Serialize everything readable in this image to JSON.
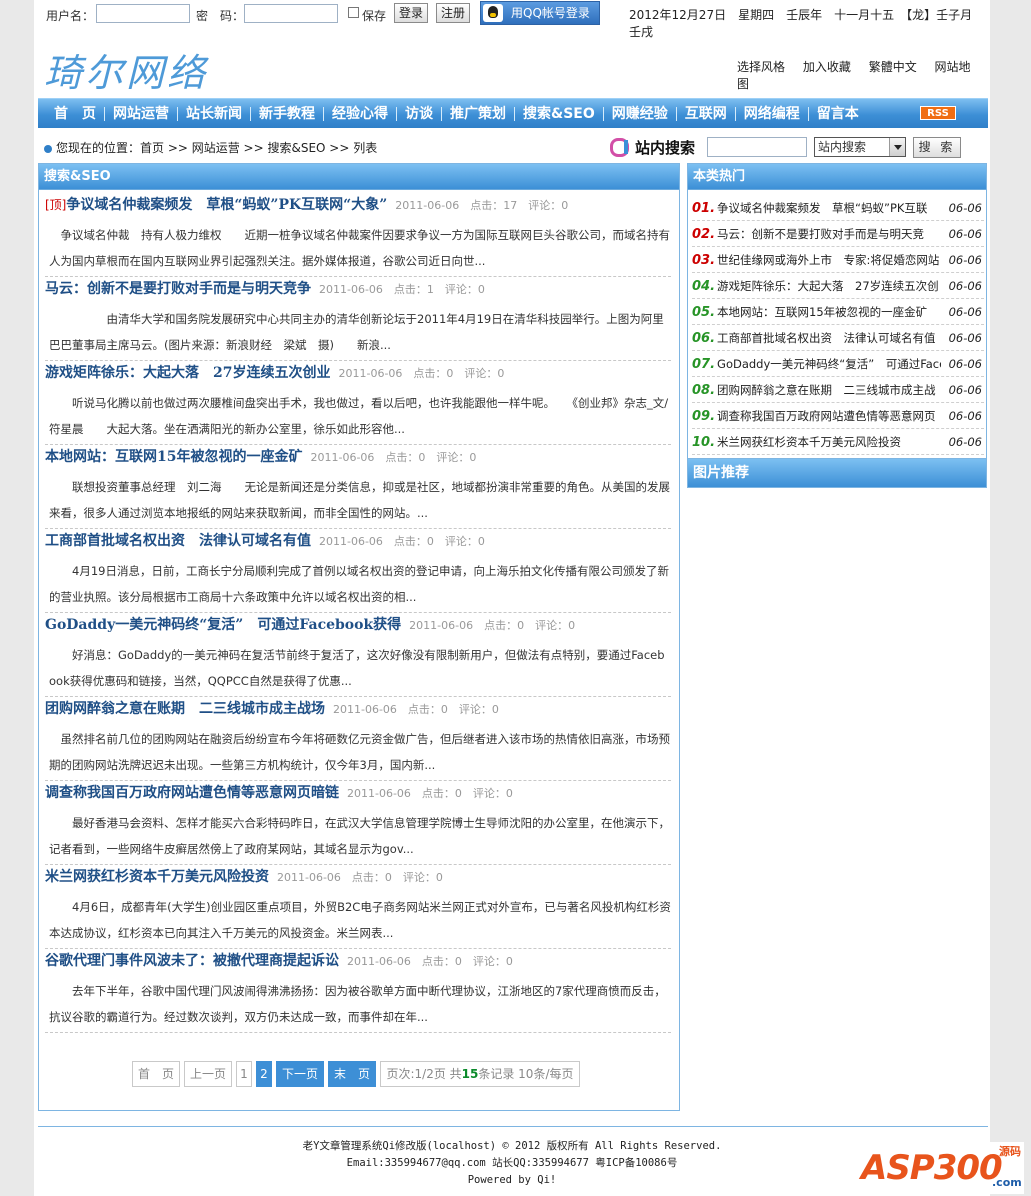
{
  "topbar": {
    "user_label": "用户名：",
    "pwd_label": "密　码：",
    "save_label": "保存",
    "login_btn": "登录",
    "register_btn": "注册",
    "qq_btn": "用QQ帐号登录",
    "date": "2012年12月27日　星期四　壬辰年　十一月十五　【龙】壬子月　壬戌"
  },
  "header": {
    "logo": "琦尔网络",
    "links": [
      "选择风格",
      "加入收藏",
      "繁體中文",
      "网站地图"
    ]
  },
  "nav": {
    "items": [
      "首　页",
      "网站运营",
      "站长新闻",
      "新手教程",
      "经验心得",
      "访谈",
      "推广策划",
      "搜索&SEO",
      "网赚经验",
      "互联网",
      "网络编程",
      "留言本"
    ],
    "rss": "RSS"
  },
  "location": {
    "text": "您现在的位置：首页 >> 网站运营 >> 搜索&SEO >> 列表"
  },
  "search": {
    "label": "站内搜索",
    "select": "站内搜索",
    "button": "搜 索"
  },
  "main": {
    "title": "搜索&SEO",
    "articles": [
      {
        "top": "[顶]",
        "title": "争议域名仲裁案频发　草根“蚂蚁”PK互联网“大象”",
        "meta": "2011-06-06　点击：17　评论：0",
        "summary": "　争议域名仲裁　持有人极力维权　　近期一桩争议域名仲裁案件因要求争议一方为国际互联网巨头谷歌公司，而域名持有人为国内草根而在国内互联网业界引起强烈关注。据外媒体报道，谷歌公司近日向世..."
      },
      {
        "top": "",
        "title": "马云：创新不是要打败对手而是与明天竞争",
        "meta": "2011-06-06　点击：1　评论：0",
        "summary": "　　　　　由清华大学和国务院发展研究中心共同主办的清华创新论坛于2011年4月19日在清华科技园举行。上图为阿里巴巴董事局主席马云。(图片来源：新浪财经　梁斌　摄)　　新浪..."
      },
      {
        "top": "",
        "title": "游戏矩阵徐乐：大起大落　27岁连续五次创业",
        "meta": "2011-06-06　点击：0　评论：0",
        "summary": "　　听说马化腾以前也做过两次腰椎间盘突出手术，我也做过，看以后吧，也许我能跟他一样牛呢。　　《创业邦》杂志_文/符星晨　　大起大落。坐在洒满阳光的新办公室里，徐乐如此形容他..."
      },
      {
        "top": "",
        "title": "本地网站：互联网15年被忽视的一座金矿",
        "meta": "2011-06-06　点击：0　评论：0",
        "summary": "　　联想投资董事总经理　刘二海　　无论是新闻还是分类信息，抑或是社区，地域都扮演非常重要的角色。从美国的发展来看，很多人通过浏览本地报纸的网站来获取新闻，而非全国性的网站。..."
      },
      {
        "top": "",
        "title": "工商部首批域名权出资　法律认可域名有值",
        "meta": "2011-06-06　点击：0　评论：0",
        "summary": "　　4月19日消息，日前，工商长宁分局顺利完成了首例以域名权出资的登记申请，向上海乐拍文化传播有限公司颁发了新的营业执照。该分局根据市工商局十六条政策中允许以域名权出资的相..."
      },
      {
        "top": "",
        "title": "GoDaddy一美元神码终“复活”　可通过Facebook获得",
        "meta": "2011-06-06　点击：0　评论：0",
        "summary": "　　好消息：GoDaddy的一美元神码在复活节前终于复活了，这次好像没有限制新用户，但做法有点特别，要通过Facebook获得优惠码和链接，当然，QQPCC自然是获得了优惠..."
      },
      {
        "top": "",
        "title": "团购网醉翁之意在账期　二三线城市成主战场",
        "meta": "2011-06-06　点击：0　评论：0",
        "summary": "　虽然排名前几位的团购网站在融资后纷纷宣布今年将砸数亿元资金做广告，但后继者进入该市场的热情依旧高涨，市场预期的团购网站洗牌迟迟未出现。一些第三方机构统计，仅今年3月，国内新..."
      },
      {
        "top": "",
        "title": "调查称我国百万政府网站遭色情等恶意网页暗链",
        "meta": "2011-06-06　点击：0　评论：0",
        "summary": "　　最好香港马会资料、怎样才能买六合彩特码昨日，在武汉大学信息管理学院博士生导师沈阳的办公室里，在他演示下，记者看到，一些网络牛皮癣居然傍上了政府某网站，其域名显示为gov..."
      },
      {
        "top": "",
        "title": "米兰网获红杉资本千万美元风险投资",
        "meta": "2011-06-06　点击：0　评论：0",
        "summary": "　　4月6日，成都青年(大学生)创业园区重点项目，外贸B2C电子商务网站米兰网正式对外宣布，已与著名风投机构红杉资本达成协议，红杉资本已向其注入千万美元的风投资金。米兰网表..."
      },
      {
        "top": "",
        "title": "谷歌代理门事件风波未了：被撤代理商提起诉讼",
        "meta": "2011-06-06　点击：0　评论：0",
        "summary": "　　去年下半年，谷歌中国代理门风波闹得沸沸扬扬：因为被谷歌单方面中断代理协议，江浙地区的7家代理商愤而反击，抗议谷歌的霸道行为。经过数次谈判，双方仍未达成一致，而事件却在年..."
      }
    ],
    "pager": {
      "first": "首　页",
      "prev": "上一页",
      "pages": [
        "1",
        "2"
      ],
      "current": "2",
      "next": "下一页",
      "last": "末　页",
      "info_a": "页次:1/2页 共",
      "info_total": "15",
      "info_b": "条记录 10条/每页"
    }
  },
  "hot": {
    "title": "本类热门",
    "items": [
      {
        "n": "01.",
        "text": "争议域名仲裁案频发　草根“蚂蚁”PK互联",
        "date": "06-06"
      },
      {
        "n": "02.",
        "text": "马云：创新不是要打败对手而是与明天竞",
        "date": "06-06"
      },
      {
        "n": "03.",
        "text": "世纪佳缘网或海外上市　专家:将促婚恋网站",
        "date": "06-06"
      },
      {
        "n": "04.",
        "text": "游戏矩阵徐乐：大起大落　27岁连续五次创",
        "date": "06-06"
      },
      {
        "n": "05.",
        "text": "本地网站：互联网15年被忽视的一座金矿",
        "date": "06-06"
      },
      {
        "n": "06.",
        "text": "工商部首批域名权出资　法律认可域名有值",
        "date": "06-06"
      },
      {
        "n": "07.",
        "text": "GoDaddy一美元神码终“复活”　可通过Face",
        "date": "06-06"
      },
      {
        "n": "08.",
        "text": "团购网醉翁之意在账期　二三线城市成主战",
        "date": "06-06"
      },
      {
        "n": "09.",
        "text": "调查称我国百万政府网站遭色情等恶意网页",
        "date": "06-06"
      },
      {
        "n": "10.",
        "text": "米兰网获红杉资本千万美元风险投资",
        "date": "06-06"
      }
    ]
  },
  "pic": {
    "title": "图片推荐"
  },
  "footer": {
    "line1": "老Y文章管理系统Qi修改版(localhost) © 2012 版权所有 All Rights Reserved.",
    "line2": "Email:335994677@qq.com 站长QQ:335994677 粤ICP备10086号",
    "line3": "Powered by Qi!"
  },
  "watermark": {
    "main": "ASP300",
    "side": "源码",
    "com": ".com"
  },
  "colors": {
    "nav": "#3d8fd6",
    "title": "#1f4f86",
    "accent_red": "#cc0000",
    "accent_green": "#279427"
  }
}
